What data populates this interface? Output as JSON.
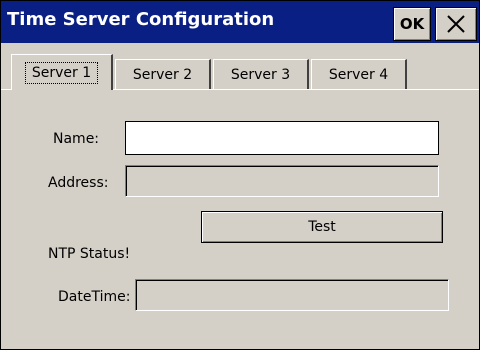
{
  "window": {
    "title": "Time Server Configuration",
    "ok_label": "OK",
    "close_glyph": "×"
  },
  "tabs": [
    {
      "label": "Server 1",
      "active": true
    },
    {
      "label": "Server 2",
      "active": false
    },
    {
      "label": "Server 3",
      "active": false
    },
    {
      "label": "Server 4",
      "active": false
    }
  ],
  "form": {
    "name_label": "Name:",
    "name_value": "",
    "address_label": "Address:",
    "address_value": "",
    "test_label": "Test",
    "status_text": "NTP Status!",
    "datetime_label": "DateTime:",
    "datetime_value": ""
  },
  "colors": {
    "titlebar": "#0a1f84",
    "face": "#d4d0c8"
  },
  "icons": {
    "close": "close-icon"
  }
}
